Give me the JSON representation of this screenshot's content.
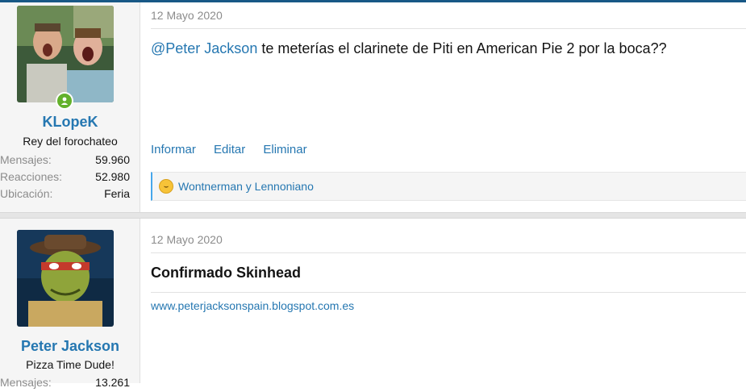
{
  "posts": [
    {
      "user": {
        "name": "KLopeK",
        "title": "Rey del forochateo",
        "stats": [
          {
            "label": "Mensajes:",
            "value": "59.960"
          },
          {
            "label": "Reacciones:",
            "value": "52.980"
          },
          {
            "label": "Ubicación:",
            "value": "Feria"
          }
        ],
        "online": true
      },
      "date": "12 Mayo 2020",
      "mention": "@Peter Jackson",
      "message": " te meterías el clarinete de Piti en American Pie 2 por la boca??",
      "actions": [
        "Informar",
        "Editar",
        "Eliminar"
      ],
      "reactions": {
        "icon": "laughing-emoji-icon",
        "users": "Wontnerman y Lennoniano"
      }
    },
    {
      "user": {
        "name": "Peter Jackson",
        "title": "Pizza Time Dude!",
        "stats": [
          {
            "label": "Mensajes:",
            "value": "13.261"
          }
        ]
      },
      "date": "12 Mayo 2020",
      "title": "Confirmado Skinhead",
      "link": "www.peterjacksonspain.blogspot.com.es"
    }
  ],
  "colors": {
    "accent": "#2577b1",
    "online": "#63b12b",
    "topbar": "#185886"
  }
}
